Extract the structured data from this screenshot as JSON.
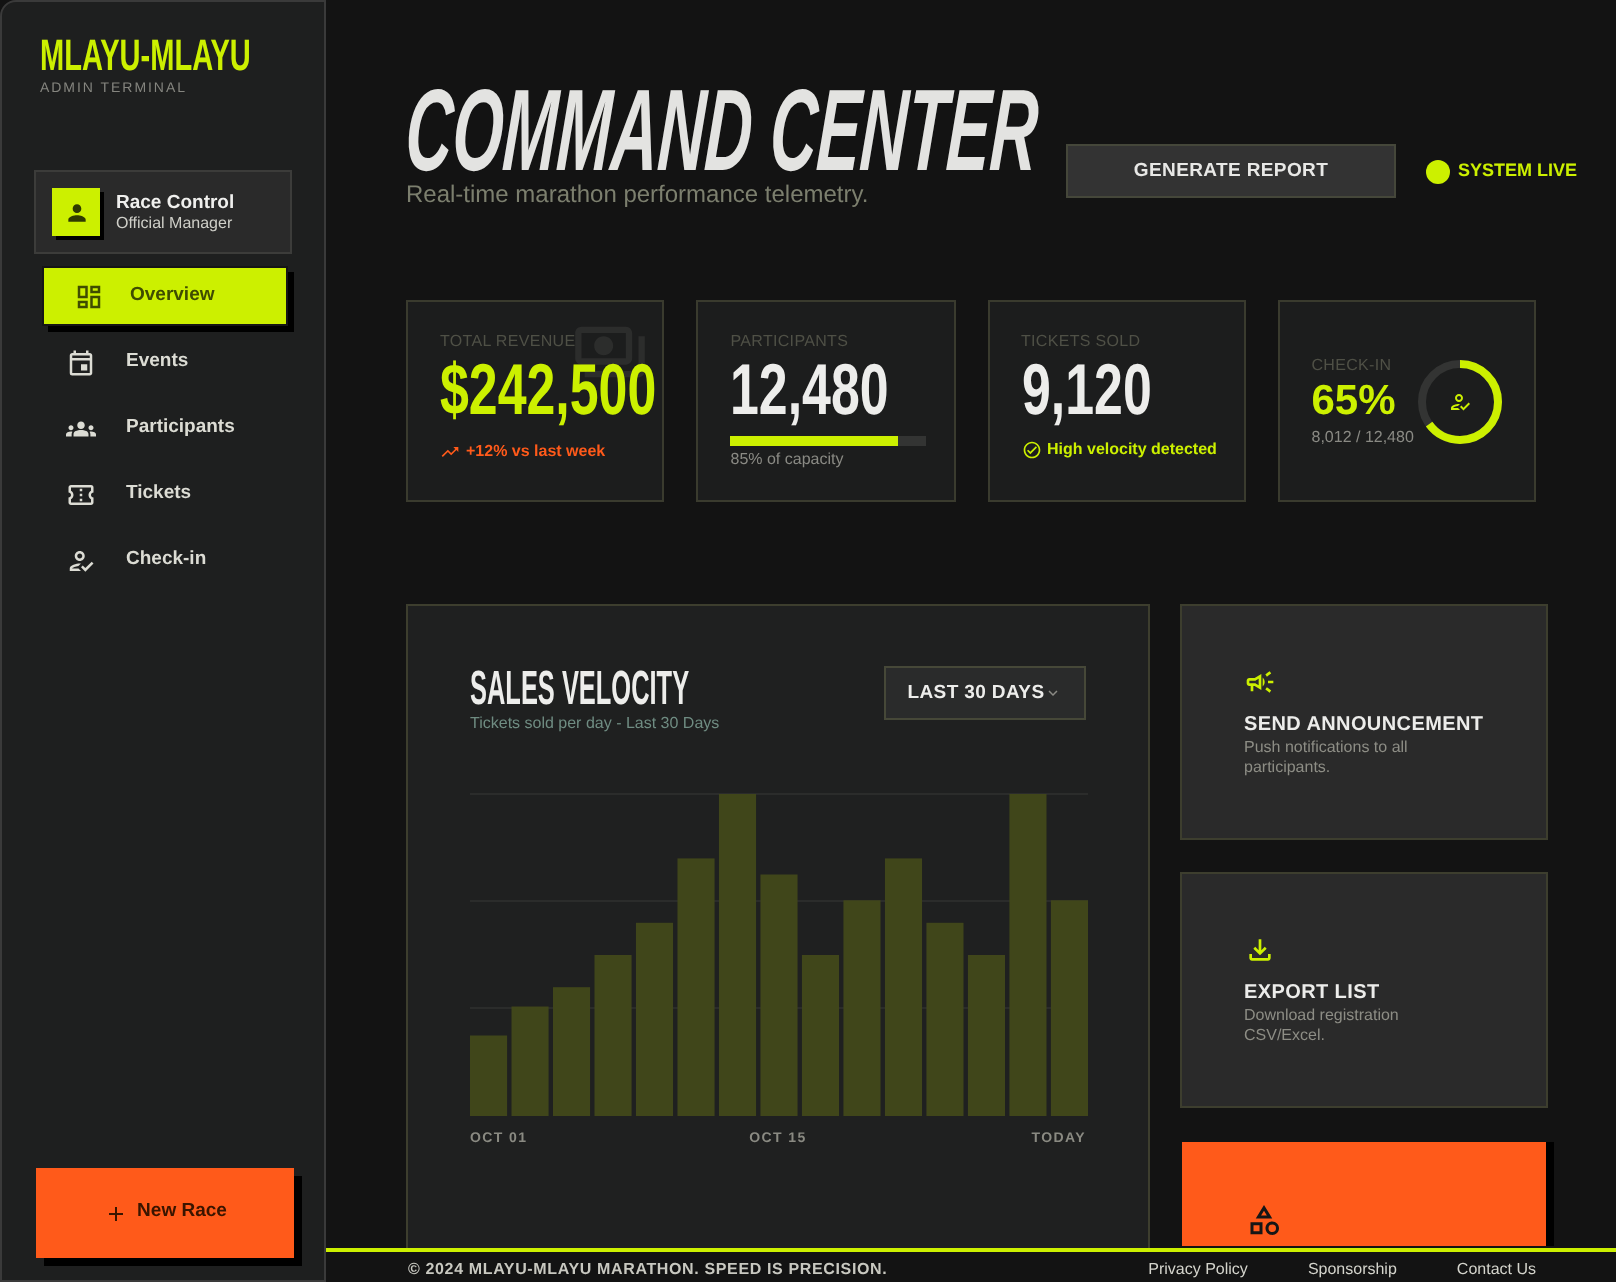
{
  "sidebar": {
    "brand": {
      "name": "MLAYU-MLAYU",
      "tagline": "ADMIN TERMINAL"
    },
    "profile": {
      "name": "Race Control",
      "role": "Official Manager"
    },
    "nav": [
      {
        "label": "Overview",
        "selected": true
      },
      {
        "label": "Events",
        "selected": false
      },
      {
        "label": "Participants",
        "selected": false
      },
      {
        "label": "Tickets",
        "selected": false
      },
      {
        "label": "Check-in",
        "selected": false
      }
    ],
    "new_race_button": "New Race"
  },
  "header": {
    "title": "COMMAND CENTER",
    "subtitle": "Real-time marathon performance telemetry.",
    "report_button": "GENERATE REPORT",
    "status": "SYSTEM LIVE"
  },
  "stats": [
    {
      "kind": "trend",
      "label": "TOTAL REVENUE",
      "value": "$242,500",
      "note": "+12% vs last week"
    },
    {
      "kind": "progress",
      "label": "PARTICIPANTS",
      "value": "12,480",
      "level": 0.85,
      "note": "85% of capacity"
    },
    {
      "kind": "status",
      "label": "TICKETS SOLD",
      "value": "9,120",
      "note": "High velocity detected"
    },
    {
      "kind": "ring",
      "label": "CHECK-IN",
      "value": "65%",
      "level": 0.65,
      "note": "8,012 / 12,480"
    }
  ],
  "sales_chart": {
    "title": "SALES VELOCITY",
    "subtitle": "Tickets sold per day - Last 30 Days",
    "range": "LAST 30 DAYS",
    "x_labels": [
      "OCT 01",
      "OCT 15",
      "TODAY"
    ]
  },
  "actions": [
    {
      "kind": "announce",
      "title": "SEND ANNOUNCEMENT",
      "description": "Push notifications to all participants."
    },
    {
      "kind": "export",
      "title": "EXPORT LIST",
      "description": "Download registration CSV/Excel."
    },
    {
      "kind": "accent"
    }
  ],
  "footer": {
    "copyright": "© 2024 MLAYU-MLAYU MARATHON. SPEED IS PRECISION.",
    "links": [
      "Privacy Policy",
      "Sponsorship",
      "Contact Us"
    ]
  }
}
